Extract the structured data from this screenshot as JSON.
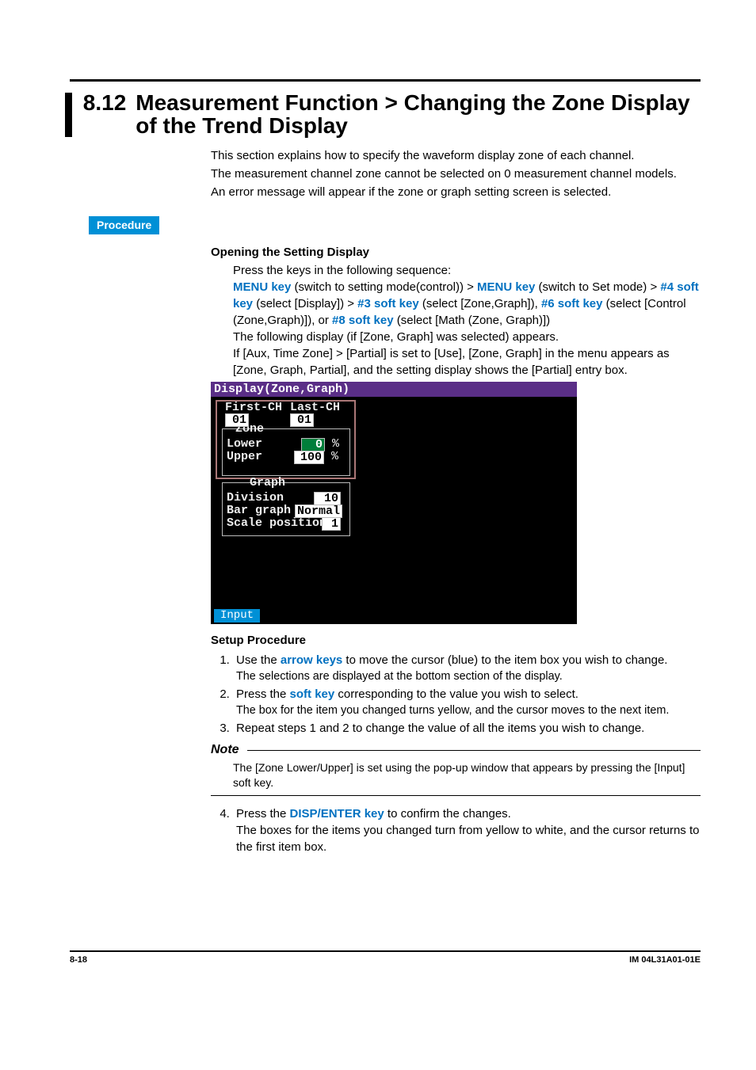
{
  "heading": {
    "number": "8.12",
    "title": "Measurement Function > Changing the Zone Display of the Trend Display"
  },
  "intro": {
    "l1": "This section explains how to specify the waveform display zone of each channel.",
    "l2": "The measurement channel zone cannot be selected on 0 measurement channel models.",
    "l3": "An error message will appear if the zone or graph setting screen is selected."
  },
  "procedure_label": "Procedure",
  "section1": {
    "title": "Opening the Setting Display",
    "leadin": "Press the keys in the following sequence:",
    "seq": {
      "menu_key": "MENU key",
      "p1": " (switch to setting mode(control)) > ",
      "p2": " (switch to Set mode) > ",
      "k4": "#4 soft key",
      "p3": " (select [Display]) > ",
      "k3": "#3 soft key",
      "p4": " (select [Zone,Graph]), ",
      "k6": "#6 soft key",
      "p5": " (select [Control (Zone,Graph)]), or ",
      "k8": "#8 soft key",
      "p6": " (select [Math (Zone, Graph)])"
    },
    "after1": "The following display (if [Zone, Graph] was selected) appears.",
    "after2": "If [Aux, Time Zone] > [Partial] is set to [Use], [Zone, Graph] in the menu appears as [Zone, Graph, Partial], and the setting display shows the [Partial] entry box."
  },
  "screenshot": {
    "title": "Display(Zone,Graph)",
    "first_ch_label": "First-CH",
    "last_ch_label": "Last-CH",
    "first_ch_val": "01",
    "last_ch_val": "01",
    "zone_label": "Zone",
    "lower_label": "Lower",
    "upper_label": "Upper",
    "lower_val": "0",
    "upper_val": "100",
    "pct": "%",
    "graph_label": "Graph",
    "division_label": "Division",
    "bargraph_label": "Bar graph",
    "scalepos_label": "Scale position",
    "division_val": "10",
    "bargraph_val": "Normal",
    "scalepos_val": "1",
    "input_btn": "Input"
  },
  "section2": {
    "title": "Setup Procedure",
    "steps": {
      "s1a": "Use the ",
      "s1k": "arrow keys",
      "s1b": " to move the cursor (blue) to the item box you wish to change.",
      "s1sub": "The selections are displayed at the bottom section of the display.",
      "s2a": "Press the ",
      "s2k": "soft key",
      "s2b": " corresponding to the value you wish to select.",
      "s2sub": "The box for the item you changed turns yellow, and the cursor moves to the next item.",
      "s3": "Repeat steps 1 and 2 to change the value of all the items you wish to change."
    }
  },
  "note": {
    "label": "Note",
    "text": "The [Zone Lower/Upper] is set using the pop-up window that appears by pressing the [Input] soft key."
  },
  "step4": {
    "a": "Press the ",
    "k": "DISP/ENTER key",
    "b": " to confirm the changes.",
    "sub": "The boxes for the items you changed turn from yellow to white, and the cursor returns to the first item box."
  },
  "footer": {
    "page": "8-18",
    "doc": "IM 04L31A01-01E"
  }
}
